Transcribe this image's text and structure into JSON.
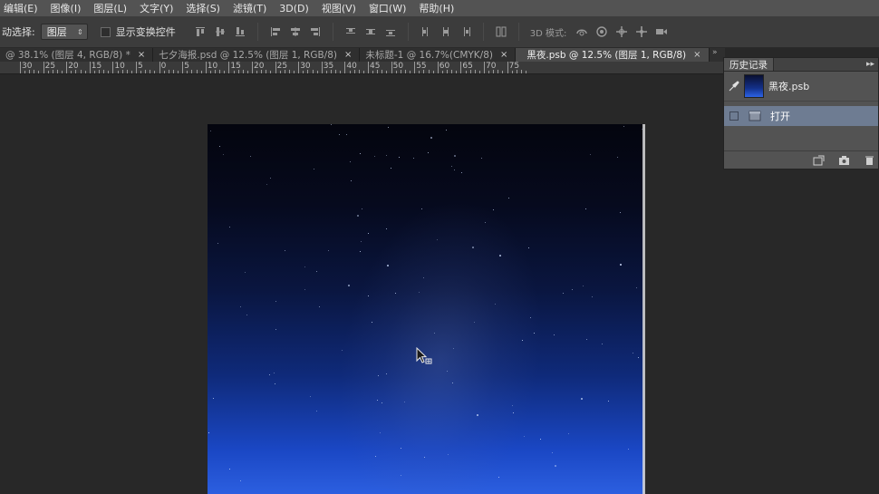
{
  "menubar": {
    "items": [
      "编辑(E)",
      "图像(I)",
      "图层(L)",
      "文字(Y)",
      "选择(S)",
      "滤镜(T)",
      "3D(D)",
      "视图(V)",
      "窗口(W)",
      "帮助(H)"
    ]
  },
  "options": {
    "auto_select_label": "动选择:",
    "auto_select_value": "图层",
    "show_transform_label": "显示变换控件",
    "mode_3d_label": "3D 模式:"
  },
  "tabs": [
    {
      "label": "@ 38.1% (图层 4, RGB/8) *",
      "active": false
    },
    {
      "label": "七夕海报.psd @ 12.5% (图层 1, RGB/8)",
      "active": false
    },
    {
      "label": "未标题-1 @ 16.7%(CMYK/8)",
      "active": false
    },
    {
      "label": "黑夜.psb @ 12.5% (图层 1, RGB/8)",
      "active": true
    }
  ],
  "tab_close_glyph": "×",
  "ruler": {
    "labels": [
      "30",
      "25",
      "20",
      "15",
      "10",
      "5",
      "0",
      "5",
      "10",
      "15",
      "20",
      "25",
      "30",
      "35",
      "40",
      "45",
      "50",
      "55",
      "60",
      "65",
      "70",
      "75"
    ]
  },
  "history_panel": {
    "title": "历史记录",
    "snapshot_name": "黑夜.psb",
    "states": [
      "打开"
    ],
    "collapse_glyph": "▸▸"
  },
  "colors": {
    "menubar_bg": "#535353",
    "workspace_bg": "#282828",
    "selected_state_bg": "#6e7c92"
  }
}
